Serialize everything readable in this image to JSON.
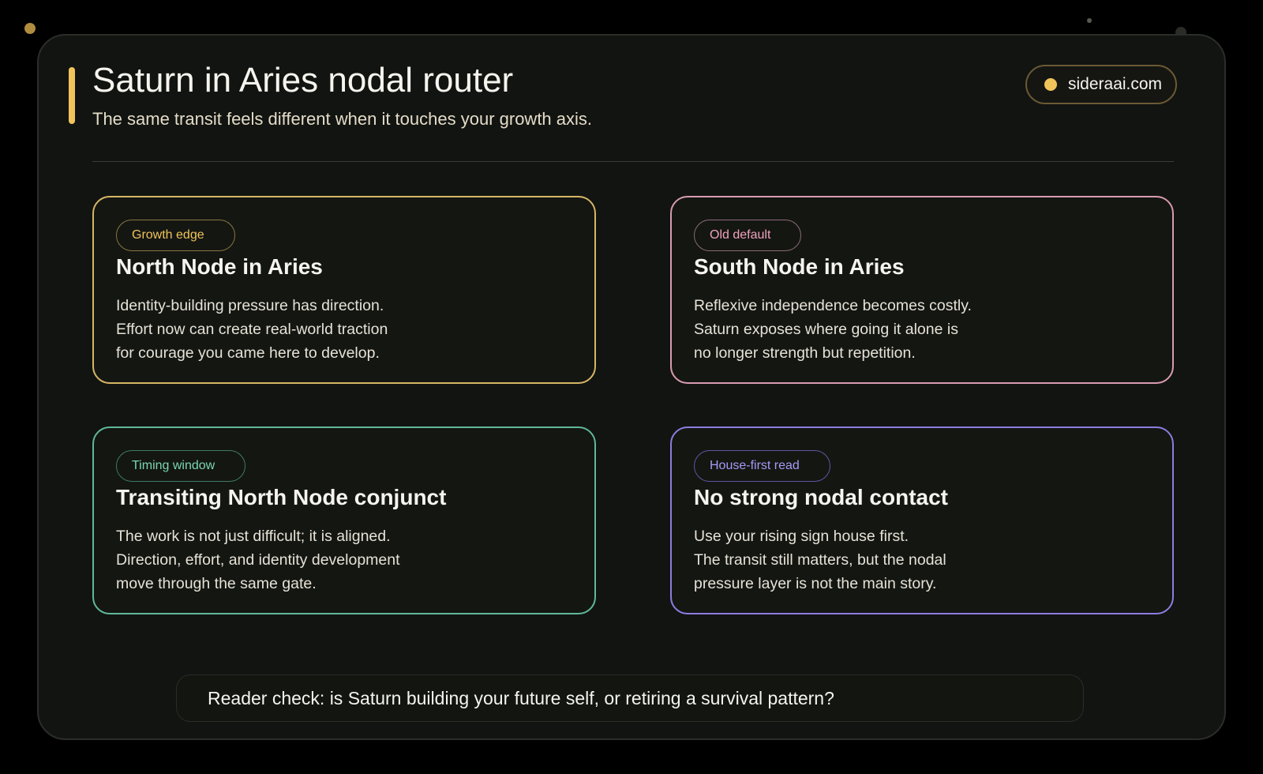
{
  "header": {
    "title": "Saturn in Aries nodal router",
    "subtitle": "The same transit feels different when it touches your growth axis.",
    "brand": "sideraai.com"
  },
  "cards": [
    {
      "tag": "Growth edge",
      "title": "North Node in Aries",
      "lines": [
        "Identity-building pressure has direction.",
        "Effort now can create real-world traction",
        "for courage you came here to develop."
      ],
      "color": "#d6b665"
    },
    {
      "tag": "Old default",
      "title": "South Node in Aries",
      "lines": [
        "Reflexive independence becomes costly.",
        "Saturn exposes where going it alone is",
        "no longer strength but repetition."
      ],
      "color": "#d99bb1"
    },
    {
      "tag": "Timing window",
      "title": "Transiting North Node conjunct",
      "lines": [
        "The work is not just difficult; it is aligned.",
        "Direction, effort, and identity development",
        "move through the same gate."
      ],
      "color": "#5fb89b"
    },
    {
      "tag": "House-first read",
      "title": "No strong nodal contact",
      "lines": [
        "Use your rising sign house first.",
        "The transit still matters, but the nodal",
        "pressure layer is not the main story."
      ],
      "color": "#8e7ce0"
    }
  ],
  "footer": {
    "text": "Reader check: is Saturn building your future self, or retiring a survival pattern?"
  },
  "colors": {
    "accent": "#f0c45a",
    "background": "#000000",
    "panel": "#121411"
  }
}
